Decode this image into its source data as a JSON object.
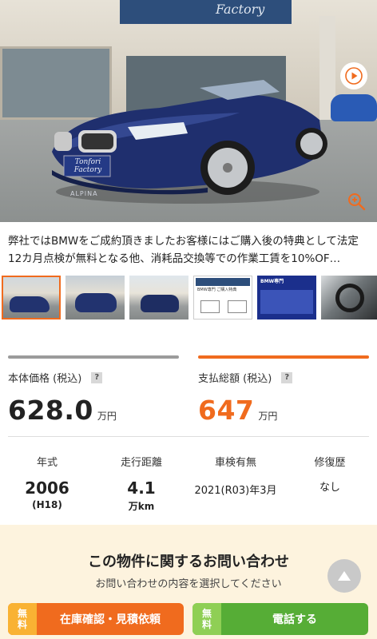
{
  "hero": {
    "sign_text": "Factory",
    "plate_text": "Tonfori Factory",
    "grille_text": "ALPINA"
  },
  "description": "弊社ではBMWをご成約頂きましたお客様にはご購入後の特典として法定12カ月点検が無料となる他、消耗品交換等での作業工賃を10%OF…",
  "thumbnails": [
    {
      "type": "car-front"
    },
    {
      "type": "car-front"
    },
    {
      "type": "car-rear"
    },
    {
      "type": "flyer"
    },
    {
      "type": "flyer-bmw"
    },
    {
      "type": "interior"
    }
  ],
  "thumb_texts": {
    "flyer1": "BMW専門 ご購入特典",
    "flyer2": "BMW専門"
  },
  "price": {
    "base_label": "本体価格 (税込)",
    "base_value": "628.0",
    "base_unit": "万円",
    "total_label": "支払総額 (税込)",
    "total_value": "647",
    "total_unit": "万円",
    "help": "?"
  },
  "specs": {
    "year_label": "年式",
    "year_value": "2006",
    "year_sub": "(H18)",
    "mileage_label": "走行距離",
    "mileage_value": "4.1",
    "mileage_unit": "万km",
    "inspection_label": "車検有無",
    "inspection_value": "2021(R03)年3月",
    "repair_label": "修復歴",
    "repair_value": "なし"
  },
  "inquiry": {
    "title": "この物件に関するお問い合わせ",
    "subtitle": "お問い合わせの内容を選択してください"
  },
  "cta": {
    "free_line1": "無",
    "free_line2": "料",
    "stock_label": "在庫確認・見積依頼",
    "phone_label": "電話する"
  },
  "colors": {
    "accent_orange": "#f06b1e",
    "accent_green": "#56ad36",
    "inquiry_bg": "#fdf3de"
  }
}
